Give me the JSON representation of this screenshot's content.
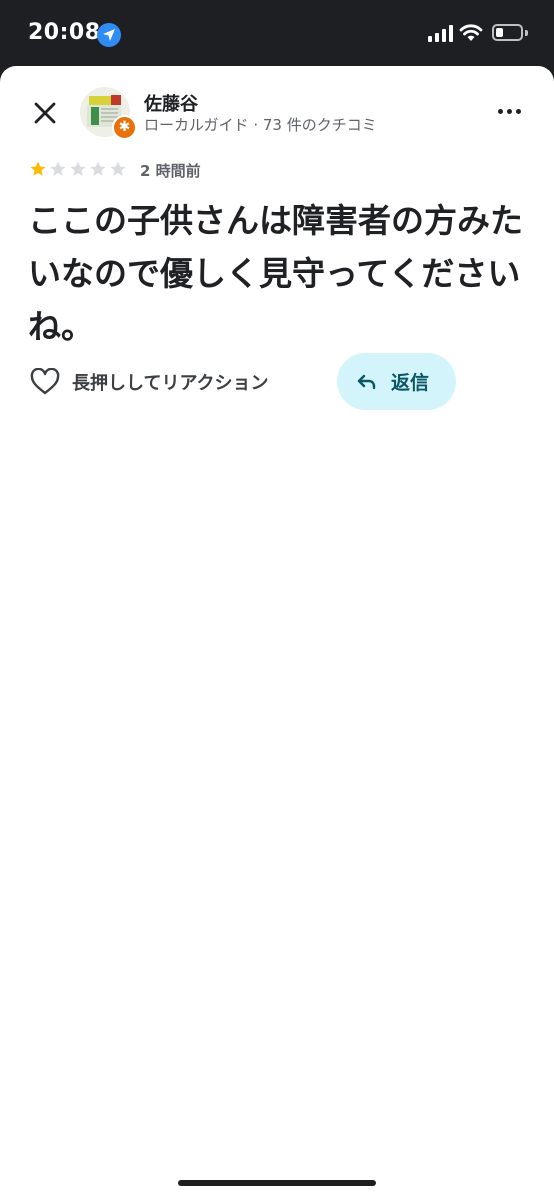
{
  "status_bar": {
    "time": "20:08",
    "location_icon": "location-arrow-icon",
    "signal_icon": "cellular-signal-icon",
    "wifi_icon": "wifi-icon",
    "battery_icon": "battery-icon",
    "battery_level": 0.2
  },
  "reviewer": {
    "name": "佐藤谷",
    "subtitle": "ローカルガイド · 73 件のクチコミ",
    "badge_icon": "local-guide-badge-icon"
  },
  "review": {
    "rating": 1,
    "max_rating": 5,
    "time_ago": "2 時間前",
    "text": "ここの子供さんは障害者の方みたいなので優しく見守ってください ね。"
  },
  "actions": {
    "react_label": "長押ししてリアクション",
    "reply_label": "返信"
  },
  "colors": {
    "accent_star": "#fbbc04",
    "reply_bg": "#d3f4fb",
    "reply_text": "#0b5767",
    "badge": "#e8710a"
  }
}
